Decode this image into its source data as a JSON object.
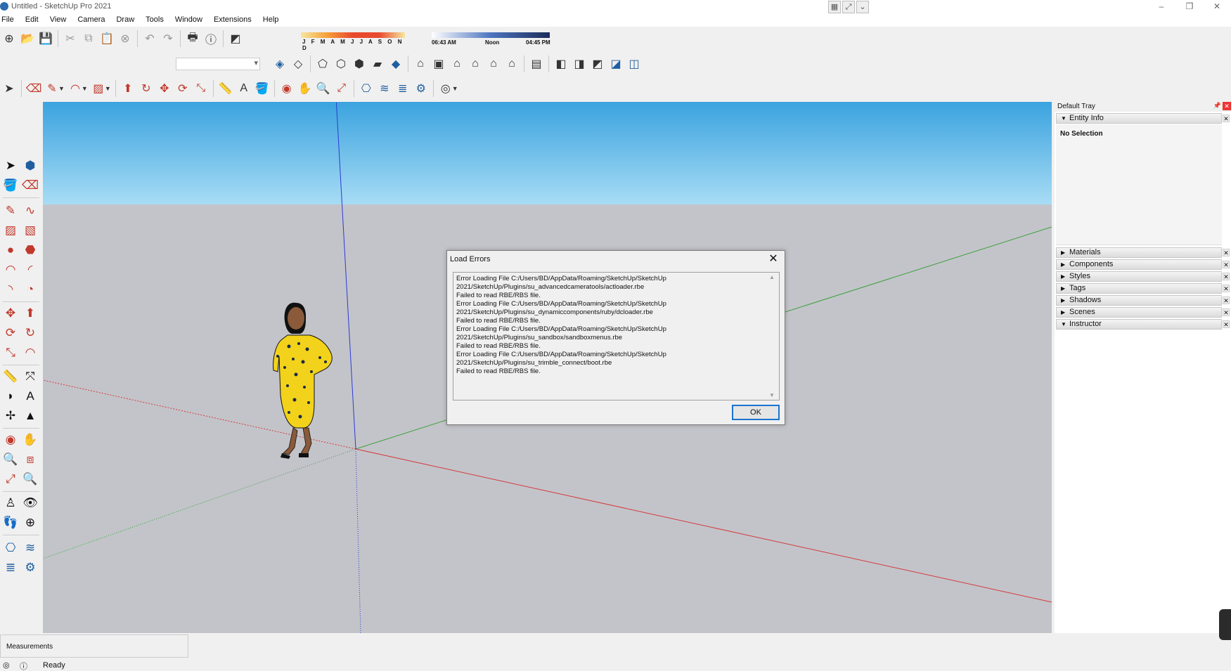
{
  "window": {
    "title": "Untitled - SketchUp Pro 2021",
    "minimize": "–",
    "restore": "❐",
    "close": "✕"
  },
  "menu": [
    "File",
    "Edit",
    "View",
    "Camera",
    "Draw",
    "Tools",
    "Window",
    "Extensions",
    "Help"
  ],
  "shadows": {
    "months": "J F M A M J J A S O N D",
    "start_time": "06:43 AM",
    "mid_time": "Noon",
    "end_time": "04:45 PM"
  },
  "dialog": {
    "title": "Load Errors",
    "close_label": "✕",
    "errors": [
      "Error Loading File C:/Users/BD/AppData/Roaming/SketchUp/SketchUp",
      "2021/SketchUp/Plugins/su_advancedcameratools/actloader.rbe",
      "Failed to read RBE/RBS file.",
      "Error Loading File C:/Users/BD/AppData/Roaming/SketchUp/SketchUp",
      "2021/SketchUp/Plugins/su_dynamiccomponents/ruby/dcloader.rbe",
      "Failed to read RBE/RBS file.",
      "Error Loading File C:/Users/BD/AppData/Roaming/SketchUp/SketchUp",
      "2021/SketchUp/Plugins/su_sandbox/sandboxmenus.rbe",
      "Failed to read RBE/RBS file.",
      "Error Loading File C:/Users/BD/AppData/Roaming/SketchUp/SketchUp",
      "2021/SketchUp/Plugins/su_trimble_connect/boot.rbe",
      "Failed to read RBE/RBS file."
    ],
    "ok_label": "OK"
  },
  "tray": {
    "title": "Default Tray",
    "entity_info": "Entity Info",
    "no_selection": "No Selection",
    "panels": [
      "Materials",
      "Components",
      "Styles",
      "Tags",
      "Shadows",
      "Scenes",
      "Instructor"
    ]
  },
  "measurements": {
    "label": "Measurements"
  },
  "status": {
    "text": "Ready"
  },
  "colors": {
    "sky_top": "#3ba3df",
    "ground": "#c3c4ca",
    "axis_red": "#d43a3a",
    "axis_green": "#3aa03a",
    "axis_blue": "#2a3ad4"
  }
}
